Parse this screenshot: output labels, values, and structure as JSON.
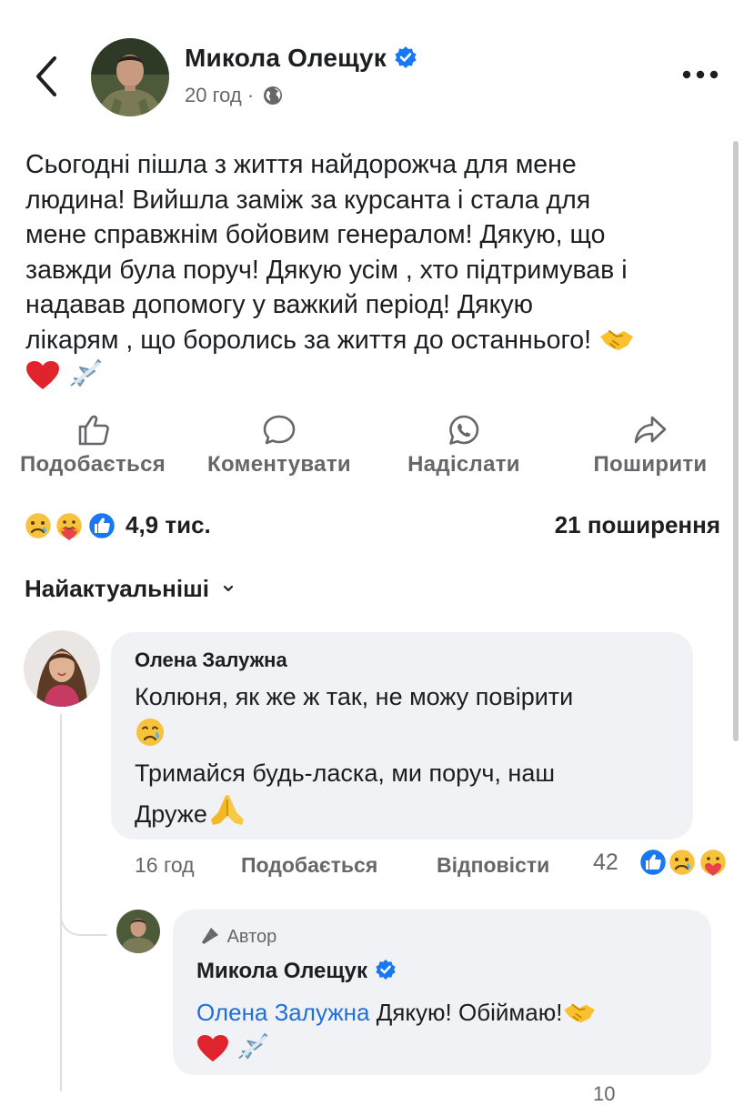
{
  "post": {
    "author": "Микола Олещук",
    "time": "20 год",
    "separator": "·",
    "text_lines": [
      "Сьогодні пішла з життя найдорожча для мене",
      "людина! Вийшла заміж за курсанта і стала для",
      "мене справжнім бойовим генералом! Дякую, що",
      "завжди була поруч! Дякую усім , хто підтримував і",
      "надавав допомогу  у важкий період! Дякую",
      "лікарям , що боролись за життя до останнього!"
    ],
    "emoji_icons": [
      "handshake-icon",
      "red-heart-icon",
      "airplane-icon"
    ]
  },
  "actions": {
    "like": "Подобається",
    "comment": "Коментувати",
    "send": "Надіслати",
    "share": "Поширити"
  },
  "stats": {
    "reactions_count": "4,9 тис.",
    "reaction_icons": [
      "sad-face-icon",
      "care-face-icon",
      "like-icon"
    ],
    "shares": "21 поширення"
  },
  "sort": {
    "label": "Найактуальніші"
  },
  "comments": [
    {
      "author": "Олена Залужна",
      "line1": "Колюня, як же ж так, не можу повірити",
      "line2": "Тримайся будь-ласка, ми поруч, наш",
      "line3": "Друже",
      "emoji_icons": [
        "crying-face-icon",
        "folded-hands-icon"
      ],
      "time": "16 год",
      "like": "Подобається",
      "reply": "Відповісти",
      "reaction_count": "42"
    }
  ],
  "reply": {
    "badge": "Автор",
    "author": "Микола Олещук",
    "mention": "Олена Залужна",
    "text": "Дякую! Обіймаю!",
    "emoji_icons": [
      "handshake-icon",
      "red-heart-icon",
      "airplane-icon"
    ],
    "reaction_count": "10"
  },
  "colors": {
    "text": "#1c1e21",
    "secondary": "#65676b",
    "bubble": "#f0f2f5",
    "link": "#216fdb",
    "verified": "#1877f2"
  }
}
